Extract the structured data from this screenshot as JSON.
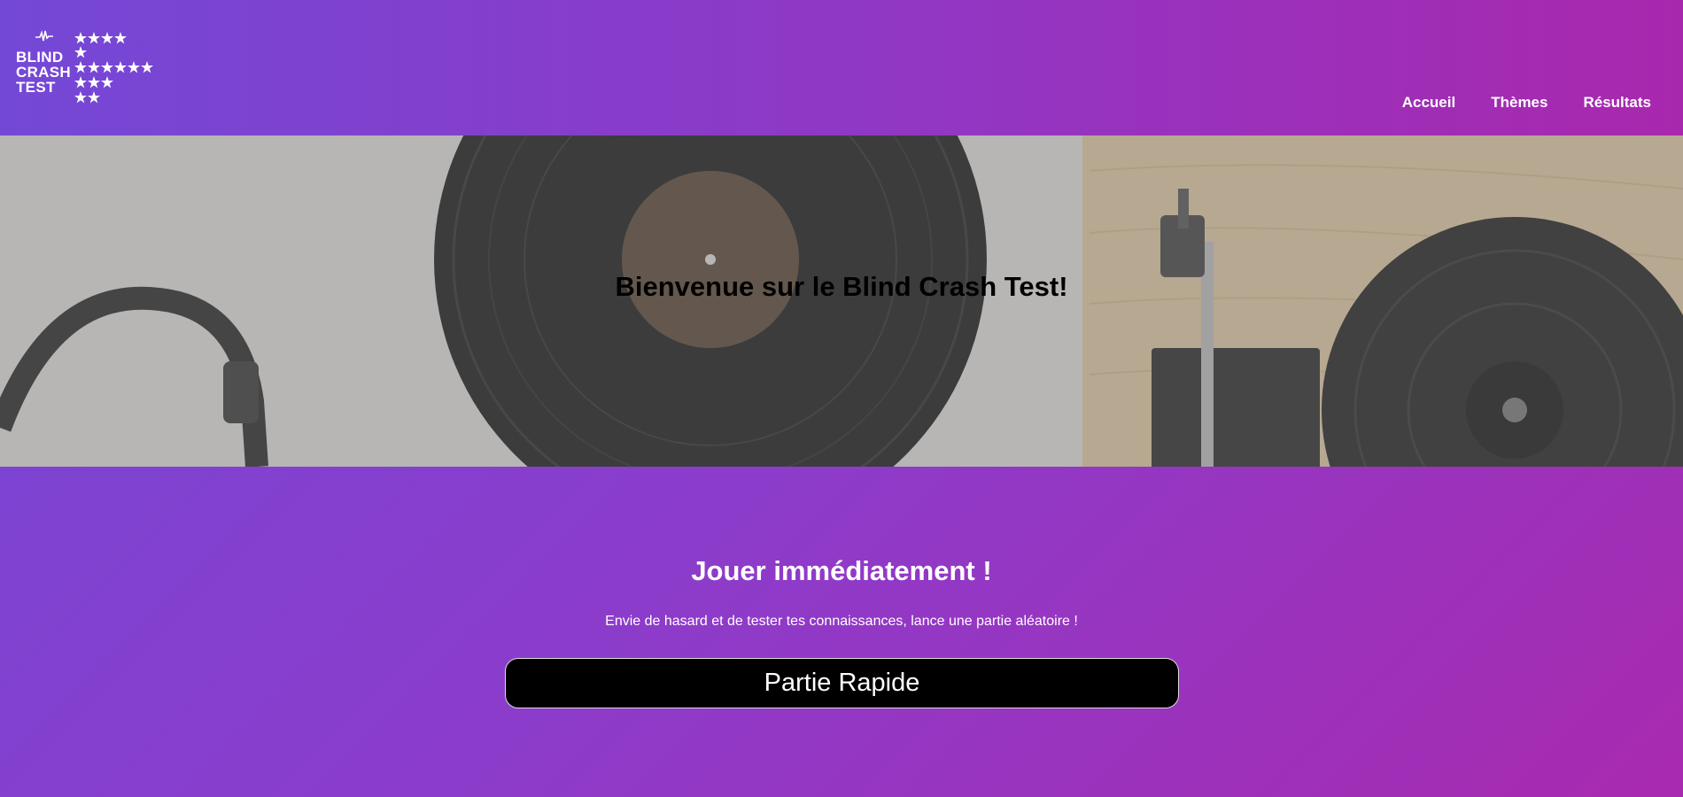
{
  "logo": {
    "lines": [
      "BLIND",
      "CRASH",
      "TEST"
    ],
    "icon": "sound-wave-icon",
    "star_icon": "star-icon"
  },
  "nav": {
    "items": [
      "Accueil",
      "Thèmes",
      "Résultats"
    ]
  },
  "hero": {
    "title": "Bienvenue sur le Blind Crash Test!"
  },
  "main": {
    "title": "Jouer immédiatement !",
    "text": "Envie de hasard et de tester tes connaissances, lance une partie aléatoire !",
    "button_label": "Partie Rapide"
  },
  "colors": {
    "gradient_start": "#7448d6",
    "gradient_end": "#a828ad",
    "button_bg": "#000000"
  }
}
